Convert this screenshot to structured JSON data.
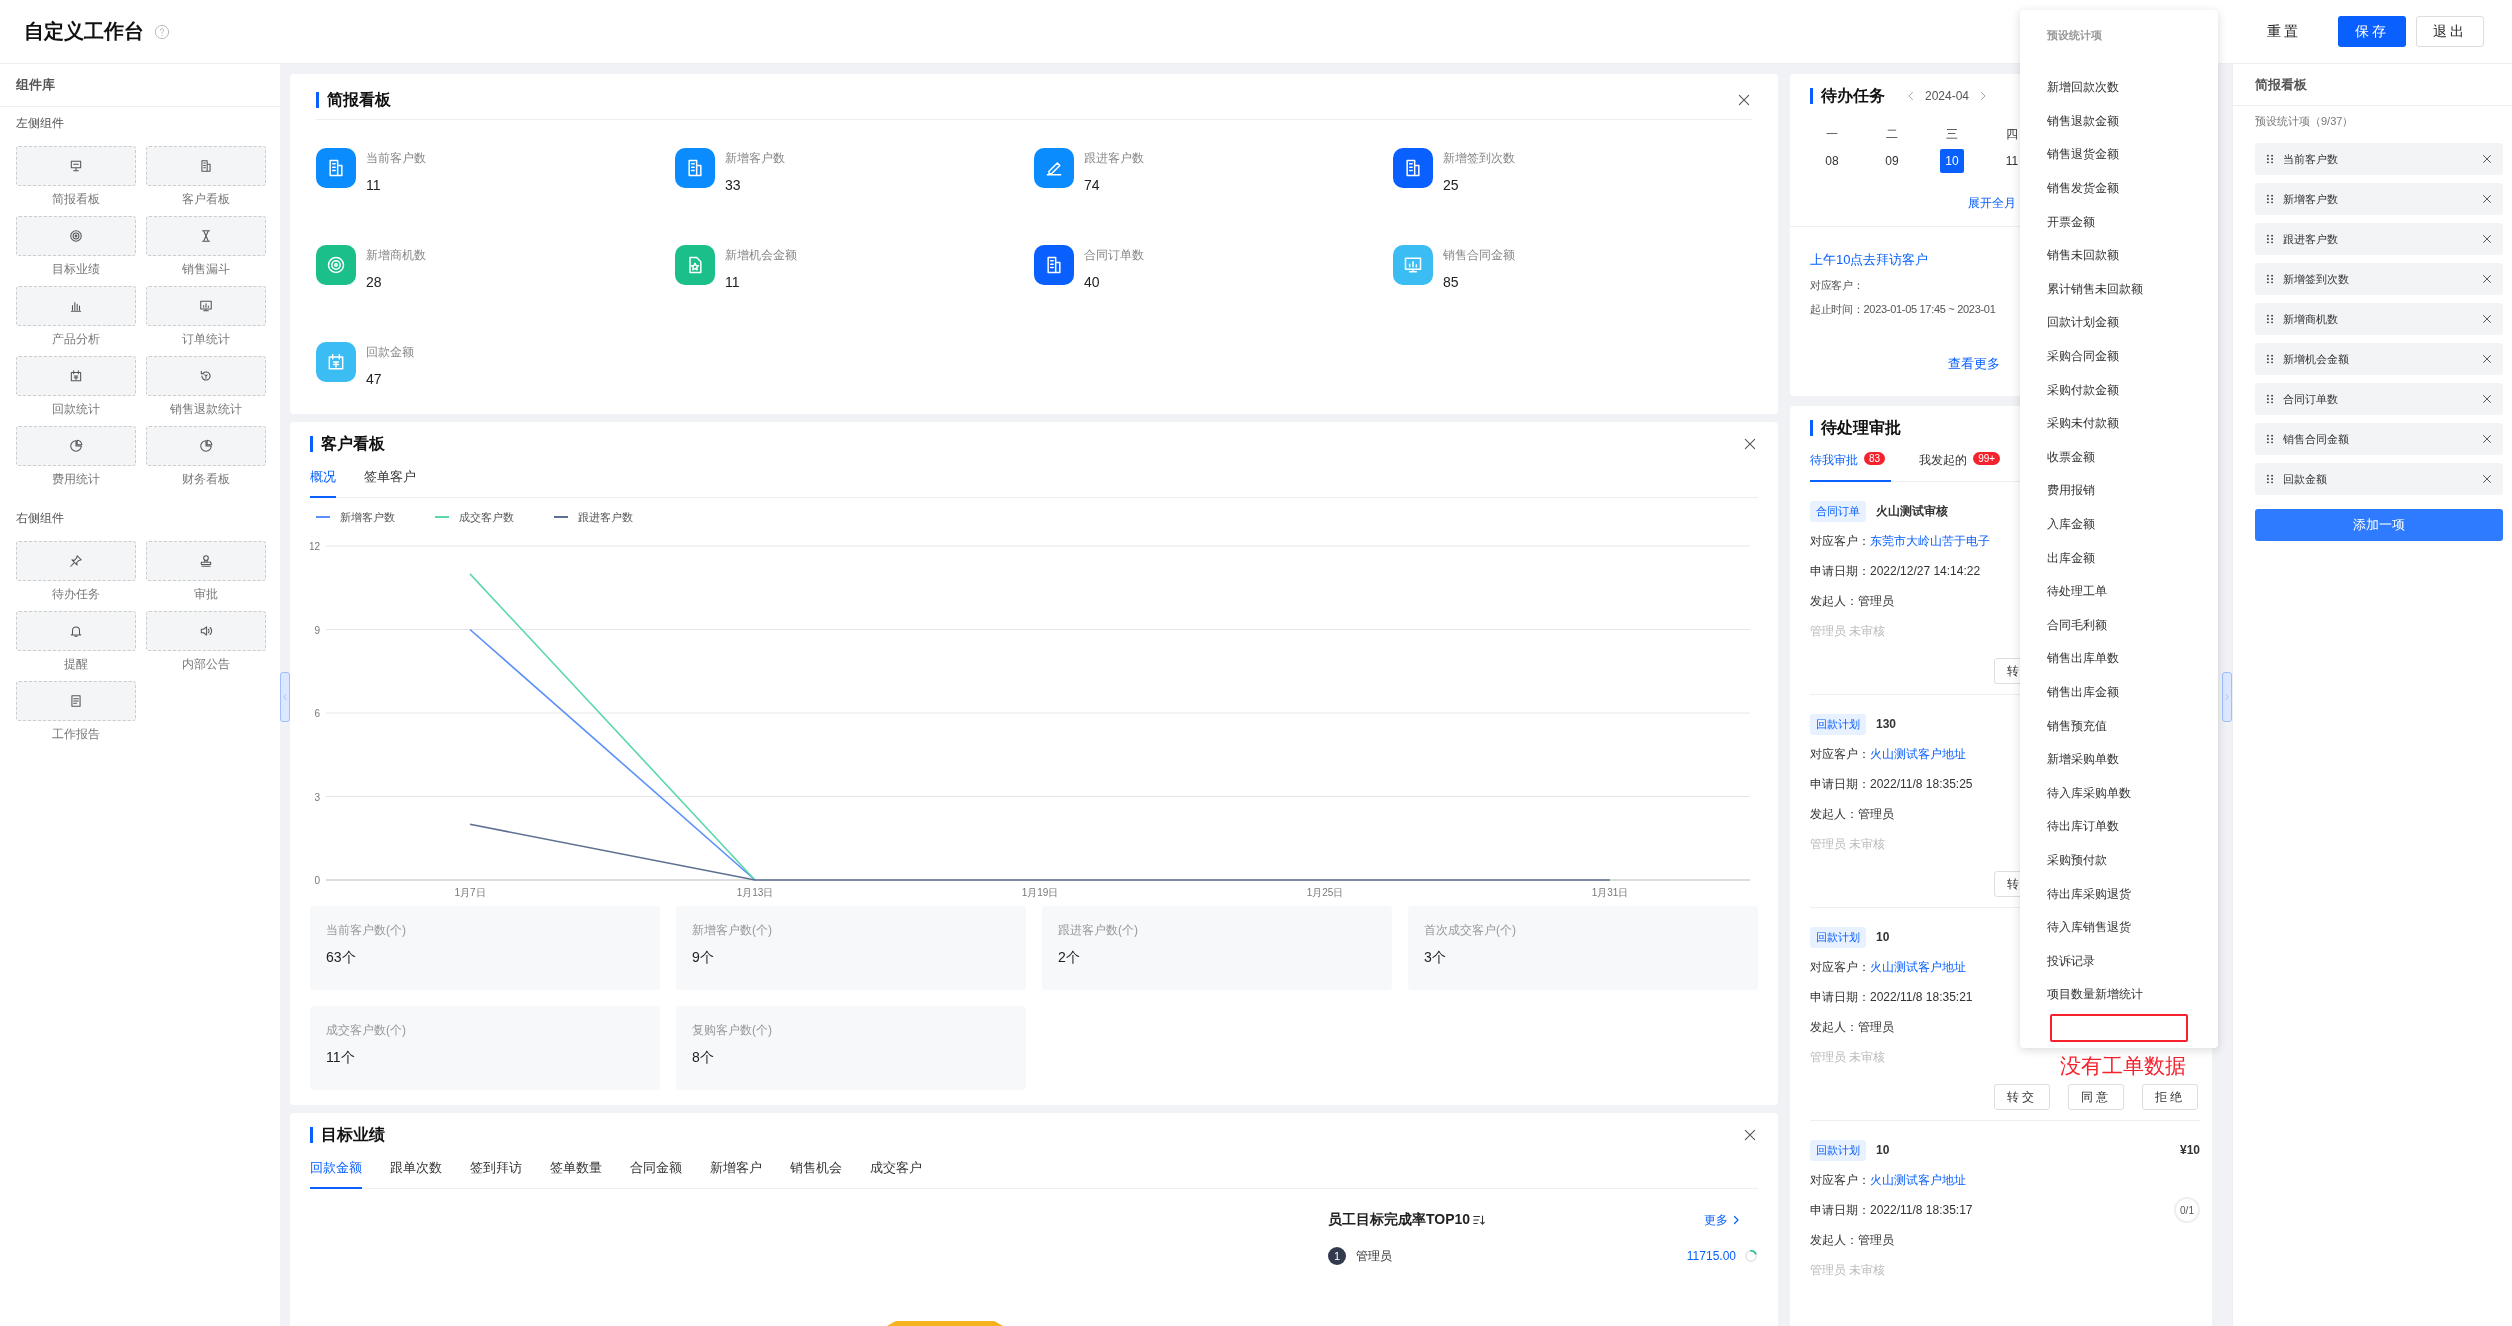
{
  "header": {
    "title": "自定义工作台",
    "buttons": [
      {
        "label": "重置",
        "kind": "text"
      },
      {
        "label": "保存",
        "kind": "primary"
      },
      {
        "label": "退出",
        "kind": "outline"
      }
    ]
  },
  "library": {
    "title": "组件库",
    "groups": [
      {
        "title": "左侧组件",
        "items": [
          "简报看板",
          "客户看板",
          "目标业绩",
          "销售漏斗",
          "产品分析",
          "订单统计",
          "回款统计",
          "销售退款统计",
          "费用统计",
          "财务看板"
        ]
      },
      {
        "title": "右侧组件",
        "items": [
          "待办任务",
          "审批",
          "提醒",
          "内部公告",
          "工作报告"
        ]
      }
    ]
  },
  "brief_board": {
    "title": "简报看板",
    "items": [
      {
        "label": "当前客户数",
        "value": "11",
        "color": "#0a8cff"
      },
      {
        "label": "新增客户数",
        "value": "33",
        "color": "#0a8cff"
      },
      {
        "label": "跟进客户数",
        "value": "74",
        "color": "#0a8cff"
      },
      {
        "label": "新增签到次数",
        "value": "25",
        "color": "#0960ff"
      },
      {
        "label": "新增商机数",
        "value": "28",
        "color": "#1bbf8a"
      },
      {
        "label": "新增机会金额",
        "value": "11",
        "color": "#1bbf8a"
      },
      {
        "label": "合同订单数",
        "value": "40",
        "color": "#0960ff"
      },
      {
        "label": "销售合同金额",
        "value": "85",
        "color": "#3bbcf2"
      },
      {
        "label": "回款金额",
        "value": "47",
        "color": "#3bbcf2"
      }
    ]
  },
  "customer_board": {
    "title": "客户看板",
    "tabs": [
      {
        "label": "概况",
        "selected": true
      },
      {
        "label": "签单客户",
        "selected": false
      }
    ],
    "chart_data": {
      "type": "line",
      "grid": true,
      "x": [
        "1月7日",
        "1月13日",
        "1月19日",
        "1月25日",
        "1月31日"
      ],
      "ylim": [
        0,
        12
      ],
      "yticks": [
        0,
        3,
        6,
        9,
        12
      ],
      "series": [
        {
          "name": "新增客户数",
          "color": "#5b8ff9",
          "values": [
            9,
            0,
            null,
            null,
            null
          ]
        },
        {
          "name": "成交客户数",
          "color": "#5ad8a6",
          "values": [
            11,
            0,
            null,
            null,
            null
          ]
        },
        {
          "name": "跟进客户数",
          "color": "#5d7092",
          "values": [
            2,
            0,
            0,
            0,
            0
          ]
        }
      ]
    },
    "stats": [
      {
        "label": "当前客户数(个)",
        "value": "63个"
      },
      {
        "label": "新增客户数(个)",
        "value": "9个"
      },
      {
        "label": "跟进客户数(个)",
        "value": "2个"
      },
      {
        "label": "首次成交客户(个)",
        "value": "3个"
      },
      {
        "label": "成交客户数(个)",
        "value": "11个"
      },
      {
        "label": "复购客户数(个)",
        "value": "8个"
      }
    ]
  },
  "target_board": {
    "title": "目标业绩",
    "tabs": [
      {
        "label": "回款金额",
        "selected": true
      },
      {
        "label": "跟单次数",
        "selected": false
      },
      {
        "label": "签到拜访",
        "selected": false
      },
      {
        "label": "签单数量",
        "selected": false
      },
      {
        "label": "合同金额",
        "selected": false
      },
      {
        "label": "新增客户",
        "selected": false
      },
      {
        "label": "销售机会",
        "selected": false
      },
      {
        "label": "成交客户",
        "selected": false
      }
    ],
    "ranking": {
      "title": "员工目标完成率TOP10",
      "more": "更多",
      "rows": [
        {
          "rank": "1",
          "name": "管理员",
          "value": "11715.00"
        }
      ]
    }
  },
  "tasks": {
    "title": "待办任务",
    "month": "2024-04",
    "weekdays": [
      "一",
      "二",
      "三",
      "四"
    ],
    "dates": [
      {
        "day": "08",
        "selected": false
      },
      {
        "day": "09",
        "selected": false
      },
      {
        "day": "10",
        "selected": true
      },
      {
        "day": "11",
        "selected": false
      }
    ],
    "expand": "展开全月",
    "items": [
      {
        "title": "上午10点去拜访客户",
        "customer": "对应客户：",
        "time": "起止时间：2023-01-05 17:45 ~ 2023-01"
      }
    ],
    "more": "查看更多"
  },
  "approvals": {
    "title": "待处理审批",
    "tabs": [
      {
        "label": "待我审批",
        "badge": "83",
        "selected": true
      },
      {
        "label": "我发起的",
        "badge": "99+",
        "selected": false
      }
    ],
    "cards": [
      {
        "tag": "合同订单",
        "title": "火山测试审核",
        "customer_label": "对应客户：",
        "customer": "东莞市大岭山苦于电子",
        "date": "申请日期：2022/12/27 14:14:22",
        "initiator": "发起人：管理员",
        "status": "管理员 未审核",
        "buttons": [
          "转"
        ]
      },
      {
        "tag": "回款计划",
        "title": "130",
        "customer_label": "对应客户：",
        "customer": "火山测试客户地址",
        "date": "申请日期：2022/11/8 18:35:25",
        "initiator": "发起人：管理员",
        "status": "管理员 未审核",
        "buttons": [
          "转"
        ]
      },
      {
        "tag": "回款计划",
        "title": "10",
        "customer_label": "对应客户：",
        "customer": "火山测试客户地址",
        "date": "申请日期：2022/11/8 18:35:21",
        "initiator": "发起人：管理员",
        "status": "管理员 未审核",
        "buttons": [
          "转交",
          "同意",
          "拒绝"
        ]
      },
      {
        "tag": "回款计划",
        "title": "10",
        "amount": "¥10",
        "customer_label": "对应客户：",
        "customer": "火山测试客户地址",
        "date": "申请日期：2022/11/8 18:35:17",
        "progress": "0/1",
        "initiator": "发起人：管理员",
        "status": "管理员 未审核"
      }
    ]
  },
  "preset_menu": {
    "header": "预设统计项",
    "items": [
      "新增回款次数",
      "销售退款金额",
      "销售退货金额",
      "销售发货金额",
      "开票金额",
      "销售未回款额",
      "累计销售未回款额",
      "回款计划金额",
      "采购合同金额",
      "采购付款金额",
      "采购未付款额",
      "收票金额",
      "费用报销",
      "入库金额",
      "出库金额",
      "待处理工单",
      "合同毛利额",
      "销售出库单数",
      "销售出库金额",
      "销售预充值",
      "新增采购单数",
      "待入库采购单数",
      "待出库订单数",
      "采购预付款",
      "待出库采购退货",
      "待入库销售退货",
      "投诉记录",
      "项目数量新增统计"
    ],
    "highlight_frame": true
  },
  "annotation": {
    "text": "没有工单数据"
  },
  "settings_panel": {
    "title": "简报看板",
    "subtitle": "预设统计项（9/37）",
    "items": [
      "当前客户数",
      "新增客户数",
      "跟进客户数",
      "新增签到次数",
      "新增商机数",
      "新增机会金额",
      "合同订单数",
      "销售合同金额",
      "回款金额"
    ],
    "add_button": "添加一项"
  }
}
